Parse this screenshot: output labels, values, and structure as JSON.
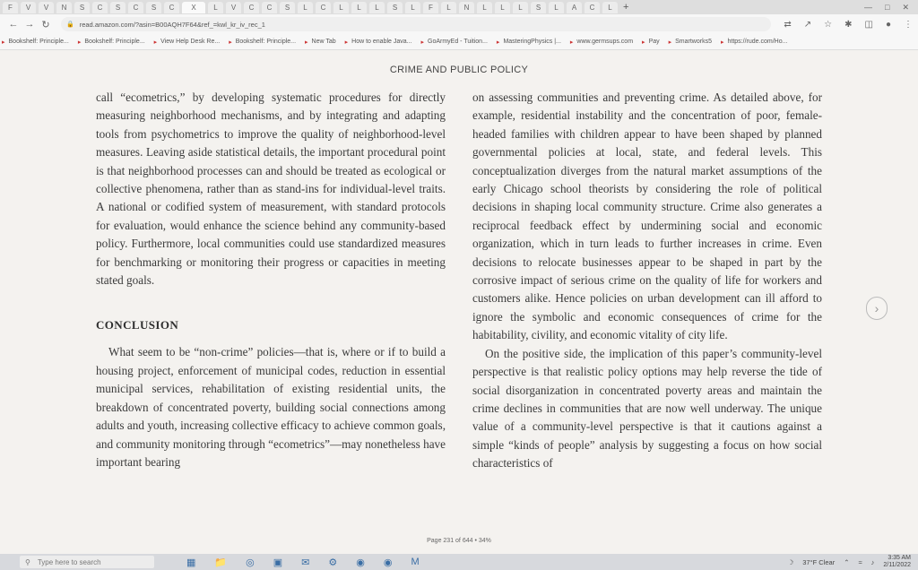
{
  "browser": {
    "tab_labels": [
      "F",
      "V",
      "V",
      "N",
      "S",
      "C",
      "S",
      "C",
      "S",
      "C",
      "X",
      "L",
      "V",
      "C",
      "C",
      "S",
      "L",
      "C",
      "L",
      "L",
      "L",
      "S",
      "L",
      "F",
      "L",
      "N",
      "L",
      "L",
      "L",
      "S",
      "L",
      "A",
      "C",
      "L"
    ],
    "new_tab": "+",
    "url": "read.amazon.com/?asin=B00AQH7F64&ref_=kwl_kr_iv_rec_1",
    "bookmarks": [
      {
        "label": "Bookshelf: Principle..."
      },
      {
        "label": "Bookshelf: Principle..."
      },
      {
        "label": "View Help Desk Re..."
      },
      {
        "label": "Bookshelf: Principle..."
      },
      {
        "label": "New Tab"
      },
      {
        "label": "How to enable Java..."
      },
      {
        "label": "GoArmyEd - Tuition..."
      },
      {
        "label": "MasteringPhysics |..."
      },
      {
        "label": "www.germsups.com"
      },
      {
        "label": "Pay"
      },
      {
        "label": "Smartworks5"
      },
      {
        "label": "https://rude.com/Ho..."
      }
    ]
  },
  "document": {
    "running_header": "CRIME AND PUBLIC POLICY",
    "left_column": {
      "p1": "call “ecometrics,” by developing systematic procedures for directly measuring neighborhood mechanisms, and by integrating and adapting tools from psychometrics to improve the quality of neighborhood-level measures. Leaving aside statistical details, the important procedural point is that neighborhood processes can and should be treated as ecological or collective phenomena, rather than as stand-ins for individual-level traits. A national or codified system of measurement, with standard protocols for evaluation, would enhance the science behind any community-based policy. Furthermore, local communities could use standardized measures for benchmarking or monitoring their progress or capacities in meeting stated goals.",
      "heading": "CONCLUSION",
      "p2": "What seem to be “non-crime” policies—that is, where or if to build a housing project, enforcement of municipal codes, reduction in essential municipal services, rehabilitation of existing residential units, the breakdown of concentrated poverty, building social connections among adults and youth, increasing collective efficacy to achieve common goals, and community monitoring through “ecometrics”—may nonetheless have important bearing"
    },
    "right_column": {
      "p1": "on assessing communities and preventing crime. As detailed above, for example, residential instability and the concentration of poor, female-headed families with children appear to have been shaped by planned governmental policies at local, state, and federal levels. This conceptualization diverges from the natural market assumptions of the early Chicago school theorists by considering the role of political decisions in shaping local community structure. Crime also generates a reciprocal feedback effect by undermining social and economic organization, which in turn leads to further increases in crime. Even decisions to relocate businesses appear to be shaped in part by the corrosive impact of serious crime on the quality of life for workers and customers alike. Hence policies on urban development can ill afford to ignore the symbolic and economic consequences of crime for the habitability, civility, and economic vitality of city life.",
      "p2": "On the positive side, the implication of this paper’s community-level perspective is that realistic policy options may help reverse the tide of social disorganization in concentrated poverty areas and maintain the crime declines in communities that are now well underway. The unique value of a community-level perspective is that it cautions against a simple “kinds of people” analysis by suggesting a focus on how social characteristics of"
    },
    "page_footer": "Page 231 of 644 • 34%"
  },
  "taskbar": {
    "search_placeholder": "Type here to search",
    "weather": "37°F Clear",
    "time": "3:35 AM",
    "date": "2/11/2022"
  }
}
